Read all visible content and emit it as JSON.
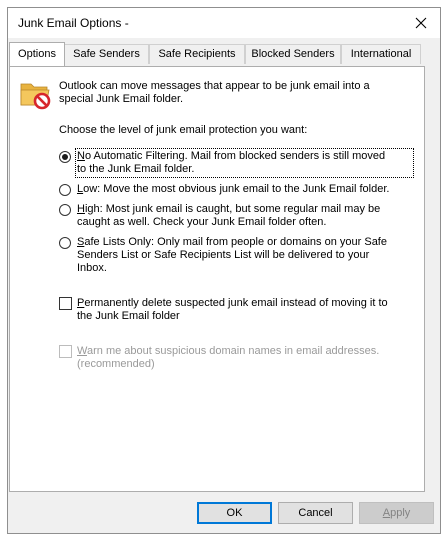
{
  "window": {
    "title": "Junk Email Options -"
  },
  "tabs": [
    {
      "label": "Options",
      "active": true
    },
    {
      "label": "Safe Senders",
      "active": false
    },
    {
      "label": "Safe Recipients",
      "active": false
    },
    {
      "label": "Blocked Senders",
      "active": false
    },
    {
      "label": "International",
      "active": false
    }
  ],
  "intro": {
    "line1": "Outlook can move messages that appear to be junk email into a",
    "line2": "special Junk Email folder."
  },
  "prompt": "Choose the level of junk email protection you want:",
  "options": {
    "no_filter": {
      "key": "N",
      "line1_rest": "o Automatic Filtering. Mail from blocked senders is still moved",
      "line2": "to the Junk Email folder.",
      "checked": true
    },
    "low": {
      "key": "L",
      "line1_rest": "ow: Move the most obvious junk email to the Junk Email folder.",
      "checked": false
    },
    "high": {
      "key": "H",
      "line1_rest": "igh: Most junk email is caught, but some regular mail may be",
      "line2": "caught as well. Check your Junk Email folder often.",
      "checked": false
    },
    "safe_lists": {
      "key": "S",
      "line1_rest": "afe Lists Only: Only mail from people or domains on your Safe",
      "line2": "Senders List or Safe Recipients List will be delivered to your",
      "line3": "Inbox.",
      "checked": false
    }
  },
  "permanently_delete": {
    "key": "P",
    "line1_rest": "ermanently delete suspected junk email instead of moving it to",
    "line2": "the Junk Email folder",
    "checked": false
  },
  "warn_suspicious": {
    "key": "W",
    "line1_rest": "arn me about suspicious domain names in email addresses.",
    "line2": "(recommended)",
    "checked": false,
    "disabled": true
  },
  "buttons": {
    "ok": "OK",
    "cancel": "Cancel",
    "apply_key": "A",
    "apply_rest": "pply"
  },
  "colors": {
    "accent": "#0078d7",
    "folder": "#f4c75d",
    "no_sign": "#d7262c"
  }
}
